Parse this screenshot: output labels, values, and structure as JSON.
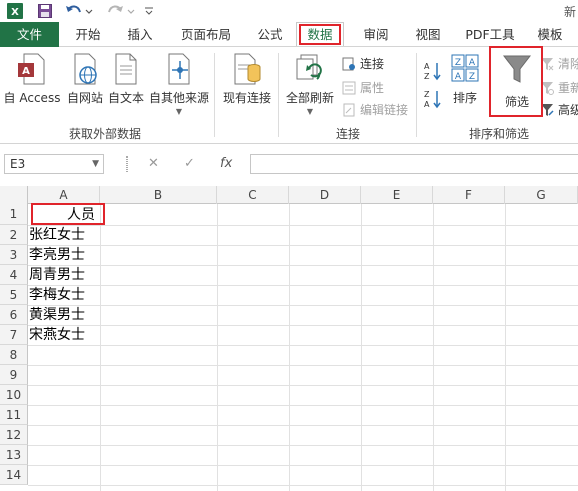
{
  "title_snippet": "新",
  "tabs": [
    "文件",
    "开始",
    "插入",
    "页面布局",
    "公式",
    "数据",
    "审阅",
    "视图",
    "PDF工具",
    "模板"
  ],
  "ribbon": {
    "external": {
      "access": "自 Access",
      "web": "自网站",
      "text": "自文本",
      "other": "自其他来源",
      "group_label": "获取外部数据"
    },
    "existing": "现有连接",
    "connections": {
      "refresh_all": "全部刷新",
      "connect": "连接",
      "properties": "属性",
      "edit_links": "编辑链接",
      "group_label": "连接"
    },
    "sort_filter": {
      "sort": "排序",
      "filter": "筛选",
      "clear": "清除",
      "reapply": "重新",
      "advanced": "高级",
      "group_label": "排序和筛选"
    }
  },
  "formula_bar": {
    "name_box": "E3",
    "cancel": "✕",
    "enter": "✓",
    "fx": "fx"
  },
  "grid": {
    "columns": [
      "A",
      "B",
      "C",
      "D",
      "E",
      "F",
      "G"
    ],
    "rows": [
      "1",
      "2",
      "3",
      "4",
      "5",
      "6",
      "7",
      "8",
      "9",
      "10",
      "11",
      "12",
      "13",
      "14"
    ],
    "cells_col_a": [
      "人员",
      "张红女士",
      "李亮男士",
      "周青男士",
      "李梅女士",
      "黄渠男士",
      "宋燕女士"
    ]
  },
  "colors": {
    "accent": "#217346",
    "highlight": "#e0242b"
  }
}
